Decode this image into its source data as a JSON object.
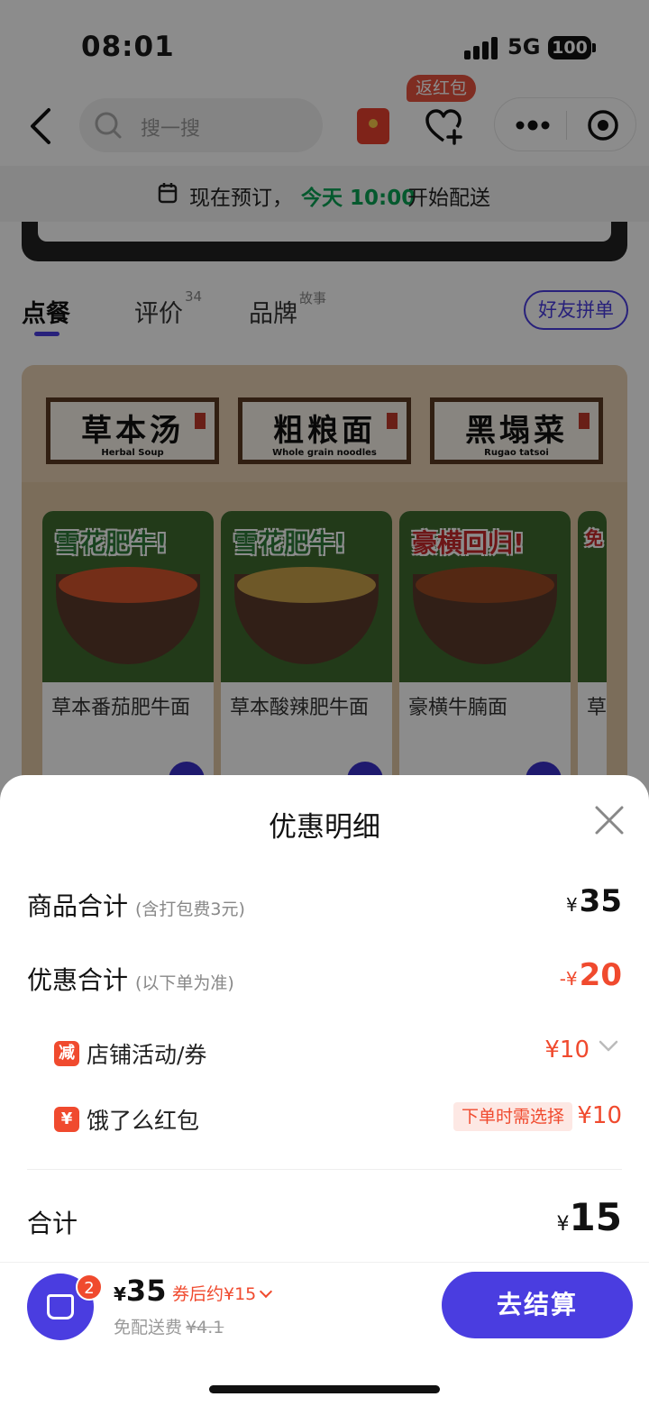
{
  "status_bar": {
    "time": "08:01",
    "network": "5G",
    "battery": "100"
  },
  "nav": {
    "search_placeholder": "搜一搜",
    "fav_badge": "返红包"
  },
  "preorder": {
    "prefix": "现在预订，",
    "highlight": "今天 10:00",
    "suffix": "开始配送"
  },
  "tabs": [
    {
      "label": "点餐",
      "sup": ""
    },
    {
      "label": "评价",
      "sup": "34"
    },
    {
      "label": "品牌",
      "sup": "故事"
    }
  ],
  "friends_button": "好友拼单",
  "categories": [
    {
      "cn": "草本汤",
      "en": "Herbal Soup"
    },
    {
      "cn": "粗粮面",
      "en": "Whole grain noodles"
    },
    {
      "cn": "黑塌菜",
      "en": "Rugao tatsoi"
    }
  ],
  "items": [
    {
      "name": "草本番茄肥牛面",
      "slogan": "雪花肥牛!"
    },
    {
      "name": "草本酸辣肥牛面",
      "slogan": "雪花肥牛!"
    },
    {
      "name": "豪横牛腩面",
      "slogan": "豪横回归!"
    },
    {
      "name": "草",
      "slogan": "免"
    }
  ],
  "sheet": {
    "title": "优惠明细",
    "goods_total": {
      "label": "商品合计",
      "note": "(含打包费3元)",
      "symbol": "¥",
      "value": "35"
    },
    "discount_total": {
      "label": "优惠合计",
      "note": "(以下单为准)",
      "symbol": "-¥",
      "value": "20"
    },
    "shop_activity": {
      "icon_text": "减",
      "label": "店铺活动/券",
      "amount": "¥10"
    },
    "eleme_redpacket": {
      "icon_text": "¥",
      "label": "饿了么红包",
      "tag": "下单时需选择",
      "amount": "¥10"
    },
    "total": {
      "label": "合计",
      "symbol": "¥",
      "value": "15"
    }
  },
  "bottom_bar": {
    "cart_count": "2",
    "price_symbol": "¥",
    "price": "35",
    "after_coupon": "券后约¥15",
    "delivery_label": "免配送费",
    "delivery_original": "¥4.1",
    "checkout": "去结算"
  },
  "colors": {
    "accent": "#4a3de0",
    "price_red": "#f04a2e",
    "preorder_green": "#0aa254"
  }
}
